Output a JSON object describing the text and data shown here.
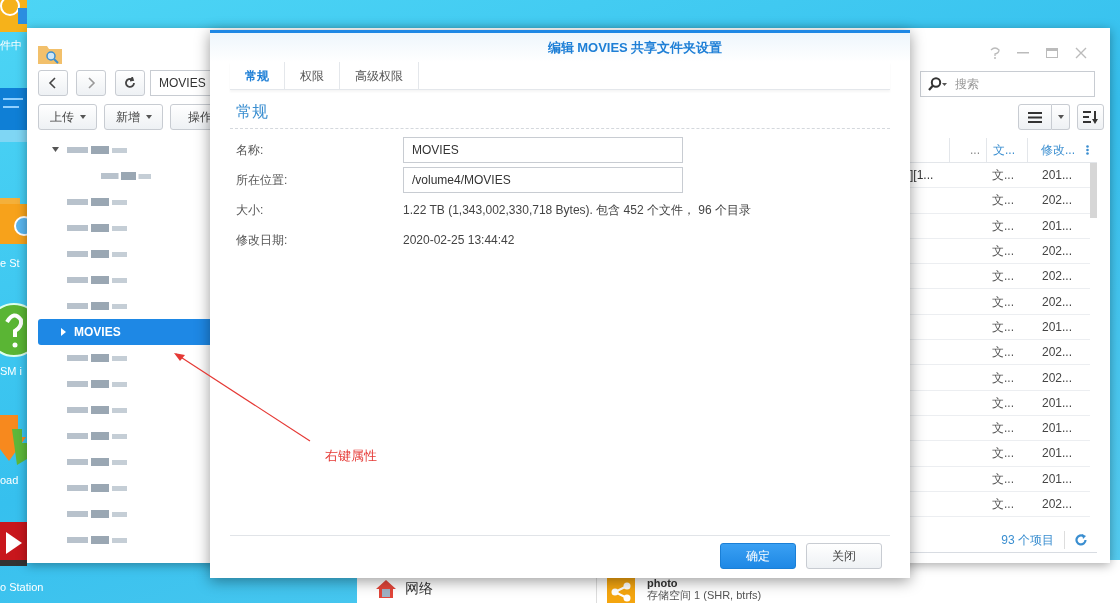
{
  "desktop": {
    "icon_labels": [
      "件中",
      "e St",
      "SM i",
      "oad",
      "o Station"
    ]
  },
  "background_window": {
    "sidebar_item": "网络",
    "share": {
      "name": "photo",
      "detail": "存储空间 1 (SHR, btrfs)"
    }
  },
  "file_station": {
    "address": "MOVIES",
    "search": {
      "placeholder": "搜索"
    },
    "toolbar": [
      "上传",
      "新增",
      "操作"
    ],
    "tree": [
      {
        "kind": "blurred",
        "expanded": true,
        "selected": false,
        "children": [
          {
            "kind": "blurred",
            "selected": false
          }
        ]
      },
      {
        "kind": "blurred",
        "selected": false
      },
      {
        "kind": "blurred",
        "selected": false
      },
      {
        "kind": "blurred",
        "selected": false
      },
      {
        "kind": "blurred",
        "selected": false
      },
      {
        "kind": "blurred",
        "selected": false
      },
      {
        "kind": "folder",
        "label": "MOVIES",
        "expanded": false,
        "selected": true
      },
      {
        "kind": "blurred",
        "selected": false
      },
      {
        "kind": "blurred",
        "selected": false
      },
      {
        "kind": "blurred",
        "selected": false
      },
      {
        "kind": "blurred",
        "selected": false
      },
      {
        "kind": "blurred",
        "selected": false
      },
      {
        "kind": "blurred",
        "selected": false
      },
      {
        "kind": "blurred",
        "selected": false
      },
      {
        "kind": "blurred",
        "selected": false
      }
    ],
    "table": {
      "columns": [
        "...",
        "文...",
        "修改..."
      ],
      "rows": [
        {
          "name": "][1...",
          "type": "文...",
          "modified": "201..."
        },
        {
          "type": "文...",
          "modified": "202..."
        },
        {
          "type": "文...",
          "modified": "201..."
        },
        {
          "type": "文...",
          "modified": "202..."
        },
        {
          "type": "文...",
          "modified": "202..."
        },
        {
          "type": "文...",
          "modified": "202..."
        },
        {
          "type": "文...",
          "modified": "201..."
        },
        {
          "type": "文...",
          "modified": "202..."
        },
        {
          "type": "文...",
          "modified": "202..."
        },
        {
          "type": "文...",
          "modified": "201..."
        },
        {
          "type": "文...",
          "modified": "201..."
        },
        {
          "type": "文...",
          "modified": "201..."
        },
        {
          "type": "文...",
          "modified": "201..."
        },
        {
          "type": "文...",
          "modified": "202..."
        }
      ]
    },
    "item_count": "93 个项目"
  },
  "dialog": {
    "title": "编辑 MOVIES 共享文件夹设置",
    "tabs": [
      {
        "label": "常规",
        "selected": true
      },
      {
        "label": "权限",
        "selected": false
      },
      {
        "label": "高级权限",
        "selected": false
      }
    ],
    "section": "常规",
    "fields": [
      {
        "kind": "input",
        "label": "名称:",
        "value": "MOVIES"
      },
      {
        "kind": "input",
        "label": "所在位置:",
        "value": "/volume4/MOVIES"
      },
      {
        "kind": "text",
        "label": "大小:",
        "value": "1.22 TB (1,343,002,330,718 Bytes). 包含 452 个文件， 96 个目录"
      },
      {
        "kind": "text",
        "label": "修改日期:",
        "value": "2020-02-25 13:44:42"
      }
    ],
    "buttons": [
      {
        "label": "确定",
        "kind": "primary"
      },
      {
        "label": "关闭",
        "kind": "secondary"
      }
    ]
  },
  "annotation": {
    "text": "右键属性"
  }
}
